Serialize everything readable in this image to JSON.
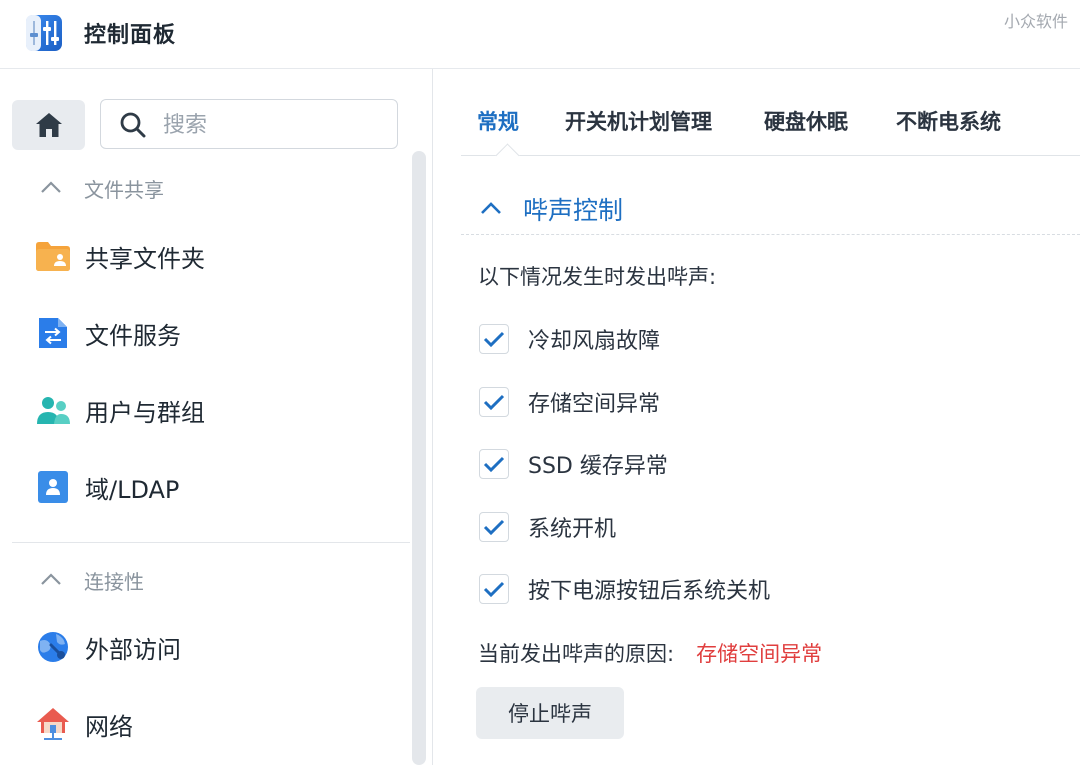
{
  "window": {
    "title": "控制面板",
    "watermark": "小众软件"
  },
  "sidebar": {
    "search": {
      "placeholder": "搜索",
      "value": ""
    },
    "sections": [
      {
        "label": "文件共享",
        "items": [
          {
            "label": "共享文件夹",
            "icon": "shared-folder-icon"
          },
          {
            "label": "文件服务",
            "icon": "file-services-icon"
          },
          {
            "label": "用户与群组",
            "icon": "users-groups-icon"
          },
          {
            "label": "域/LDAP",
            "icon": "domain-ldap-icon"
          }
        ]
      },
      {
        "label": "连接性",
        "items": [
          {
            "label": "外部访问",
            "icon": "external-access-icon"
          },
          {
            "label": "网络",
            "icon": "network-icon"
          }
        ]
      }
    ]
  },
  "main": {
    "tabs": [
      {
        "label": "常规",
        "active": true
      },
      {
        "label": "开关机计划管理",
        "active": false
      },
      {
        "label": "硬盘休眠",
        "active": false
      },
      {
        "label": "不断电系统",
        "active": false
      }
    ],
    "section_title": "哔声控制",
    "description": "以下情况发生时发出哔声:",
    "options": [
      {
        "label": "冷却风扇故障",
        "checked": true
      },
      {
        "label": "存储空间异常",
        "checked": true
      },
      {
        "label": "SSD 缓存异常",
        "checked": true
      },
      {
        "label": "系统开机",
        "checked": true
      },
      {
        "label": "按下电源按钮后系统关机",
        "checked": true
      }
    ],
    "reason_label": "当前发出哔声的原因:",
    "reason_value": "存储空间异常",
    "stop_button": "停止哔声"
  },
  "colors": {
    "accent": "#1e6fc2",
    "alert": "#e03e3e",
    "sidebar_selected": "#e8ebef"
  }
}
